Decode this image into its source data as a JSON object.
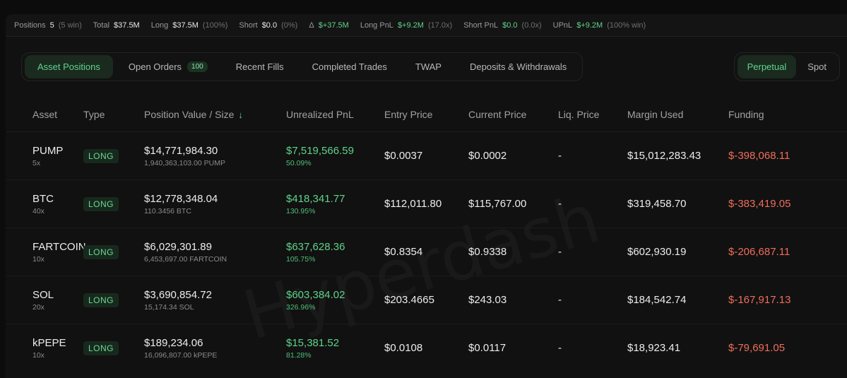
{
  "stats": {
    "positions_label": "Positions",
    "positions_value": "5",
    "positions_sub": "(5 win)",
    "total_label": "Total",
    "total_value": "$37.5M",
    "long_label": "Long",
    "long_value": "$37.5M",
    "long_sub": "(100%)",
    "short_label": "Short",
    "short_value": "$0.0",
    "short_sub": "(0%)",
    "delta_label": "Δ",
    "delta_value": "$+37.5M",
    "longpnl_label": "Long PnL",
    "longpnl_value": "$+9.2M",
    "longpnl_sub": "(17.0x)",
    "shortpnl_label": "Short PnL",
    "shortpnl_value": "$0.0",
    "shortpnl_sub": "(0.0x)",
    "upnl_label": "UPnL",
    "upnl_value": "$+9.2M",
    "upnl_sub": "(100% win)"
  },
  "tabs": {
    "asset_positions": "Asset Positions",
    "open_orders": "Open Orders",
    "open_orders_count": "100",
    "recent_fills": "Recent Fills",
    "completed_trades": "Completed Trades",
    "twap": "TWAP",
    "deposits": "Deposits & Withdrawals"
  },
  "segment": {
    "perpetual": "Perpetual",
    "spot": "Spot"
  },
  "columns": {
    "asset": "Asset",
    "type": "Type",
    "position": "Position Value / Size",
    "upnl": "Unrealized PnL",
    "entry": "Entry Price",
    "current": "Current Price",
    "liq": "Liq. Price",
    "margin": "Margin Used",
    "funding": "Funding"
  },
  "rows": [
    {
      "asset": "PUMP",
      "leverage": "5x",
      "type": "LONG",
      "value": "$14,771,984.30",
      "size": "1,940,363,103.00 PUMP",
      "upnl": "$7,519,566.59",
      "upnl_pct": "50.09%",
      "entry": "$0.0037",
      "current": "$0.0002",
      "liq": "-",
      "margin": "$15,012,283.43",
      "funding": "$-398,068.11"
    },
    {
      "asset": "BTC",
      "leverage": "40x",
      "type": "LONG",
      "value": "$12,778,348.04",
      "size": "110.3456 BTC",
      "upnl": "$418,341.77",
      "upnl_pct": "130.95%",
      "entry": "$112,011.80",
      "current": "$115,767.00",
      "liq": "-",
      "margin": "$319,458.70",
      "funding": "$-383,419.05"
    },
    {
      "asset": "FARTCOIN",
      "leverage": "10x",
      "type": "LONG",
      "value": "$6,029,301.89",
      "size": "6,453,697.00 FARTCOIN",
      "upnl": "$637,628.36",
      "upnl_pct": "105.75%",
      "entry": "$0.8354",
      "current": "$0.9338",
      "liq": "-",
      "margin": "$602,930.19",
      "funding": "$-206,687.11"
    },
    {
      "asset": "SOL",
      "leverage": "20x",
      "type": "LONG",
      "value": "$3,690,854.72",
      "size": "15,174.34 SOL",
      "upnl": "$603,384.02",
      "upnl_pct": "326.96%",
      "entry": "$203.4665",
      "current": "$243.03",
      "liq": "-",
      "margin": "$184,542.74",
      "funding": "$-167,917.13"
    },
    {
      "asset": "kPEPE",
      "leverage": "10x",
      "type": "LONG",
      "value": "$189,234.06",
      "size": "16,096,807.00 kPEPE",
      "upnl": "$15,381.52",
      "upnl_pct": "81.28%",
      "entry": "$0.0108",
      "current": "$0.0117",
      "liq": "-",
      "margin": "$18,923.41",
      "funding": "$-79,691.05"
    }
  ],
  "watermark": "Hyperdash",
  "colors": {
    "accent_green": "#5fd38a",
    "negative_red": "#ef6d5c",
    "background": "#111111"
  }
}
